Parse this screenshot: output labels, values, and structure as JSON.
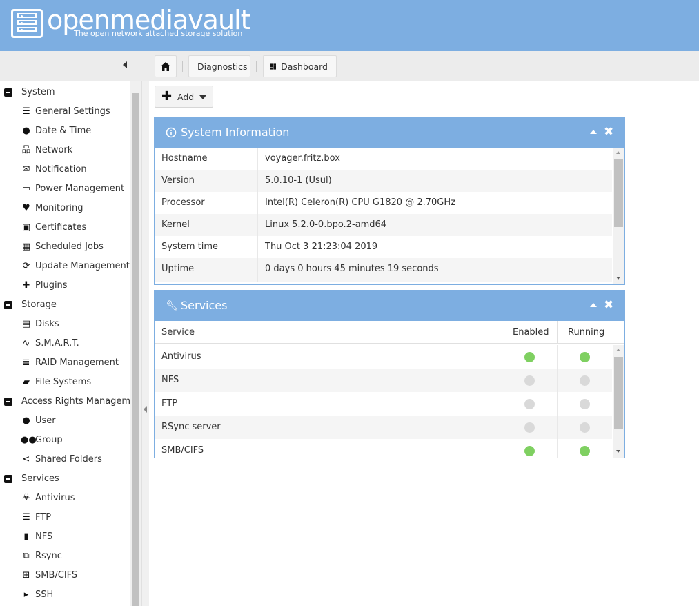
{
  "header": {
    "title": "openmediavault",
    "subtitle": "The open network attached storage solution"
  },
  "breadcrumb": {
    "home_icon": "home-icon",
    "items": [
      {
        "label": "Diagnostics"
      },
      {
        "label": "Dashboard",
        "icon": "dashboard-icon"
      }
    ]
  },
  "toolbar": {
    "add_label": "Add"
  },
  "sidebar": {
    "groups": [
      {
        "label": "System",
        "items": [
          {
            "label": "General Settings",
            "icon": "sliders-icon"
          },
          {
            "label": "Date & Time",
            "icon": "clock-icon"
          },
          {
            "label": "Network",
            "icon": "network-icon"
          },
          {
            "label": "Notification",
            "icon": "envelope-icon"
          },
          {
            "label": "Power Management",
            "icon": "battery-icon"
          },
          {
            "label": "Monitoring",
            "icon": "heartbeat-icon"
          },
          {
            "label": "Certificates",
            "icon": "certificate-icon"
          },
          {
            "label": "Scheduled Jobs",
            "icon": "calendar-clock-icon"
          },
          {
            "label": "Update Management",
            "icon": "refresh-icon"
          },
          {
            "label": "Plugins",
            "icon": "puzzle-icon"
          }
        ]
      },
      {
        "label": "Storage",
        "items": [
          {
            "label": "Disks",
            "icon": "disk-icon"
          },
          {
            "label": "S.M.A.R.T.",
            "icon": "pulse-icon"
          },
          {
            "label": "RAID Management",
            "icon": "database-icon"
          },
          {
            "label": "File Systems",
            "icon": "folders-icon"
          }
        ]
      },
      {
        "label": "Access Rights Management",
        "items": [
          {
            "label": "User",
            "icon": "user-icon"
          },
          {
            "label": "Group",
            "icon": "group-icon"
          },
          {
            "label": "Shared Folders",
            "icon": "share-icon"
          }
        ]
      },
      {
        "label": "Services",
        "items": [
          {
            "label": "Antivirus",
            "icon": "biohazard-icon"
          },
          {
            "label": "FTP",
            "icon": "server-icon"
          },
          {
            "label": "NFS",
            "icon": "nfs-icon"
          },
          {
            "label": "Rsync",
            "icon": "rsync-icon"
          },
          {
            "label": "SMB/CIFS",
            "icon": "windows-icon"
          },
          {
            "label": "SSH",
            "icon": "terminal-icon"
          }
        ]
      }
    ]
  },
  "system_info": {
    "title": "System Information",
    "rows": [
      {
        "key": "Hostname",
        "value": "voyager.fritz.box"
      },
      {
        "key": "Version",
        "value": "5.0.10-1 (Usul)"
      },
      {
        "key": "Processor",
        "value": "Intel(R) Celeron(R) CPU G1820 @ 2.70GHz"
      },
      {
        "key": "Kernel",
        "value": "Linux 5.2.0-0.bpo.2-amd64"
      },
      {
        "key": "System time",
        "value": "Thu Oct 3 21:23:04 2019"
      },
      {
        "key": "Uptime",
        "value": "0 days 0 hours 45 minutes 19 seconds"
      }
    ]
  },
  "services": {
    "title": "Services",
    "columns": {
      "service": "Service",
      "enabled": "Enabled",
      "running": "Running"
    },
    "rows": [
      {
        "name": "Antivirus",
        "enabled": true,
        "running": true
      },
      {
        "name": "NFS",
        "enabled": false,
        "running": false
      },
      {
        "name": "FTP",
        "enabled": false,
        "running": false
      },
      {
        "name": "RSync server",
        "enabled": false,
        "running": false
      },
      {
        "name": "SMB/CIFS",
        "enabled": true,
        "running": true
      }
    ]
  },
  "colors": {
    "header": "#7daee1",
    "status_on": "#7fd061",
    "status_off": "#d9d9d9"
  }
}
